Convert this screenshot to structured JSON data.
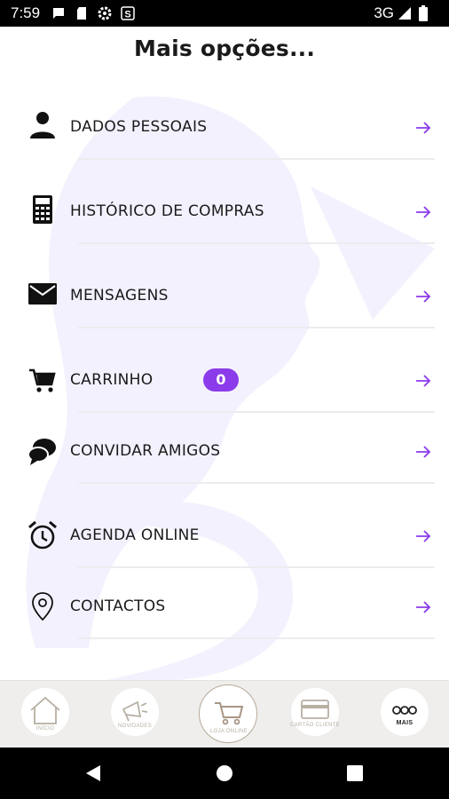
{
  "status_bar": {
    "time": "7:59",
    "network": "3G",
    "icons": [
      "message-icon",
      "sd-card-icon",
      "settings-icon",
      "s-app-icon",
      "signal-icon",
      "battery-icon"
    ]
  },
  "header": {
    "title": "Mais opções..."
  },
  "menu": {
    "accent_color": "#8b3be9",
    "items": [
      {
        "label": "DADOS PESSOAIS",
        "icon": "person-icon"
      },
      {
        "label": "HISTÓRICO DE COMPRAS",
        "icon": "calculator-icon"
      },
      {
        "label": "MENSAGENS",
        "icon": "mail-icon"
      },
      {
        "label": "CARRINHO",
        "icon": "cart-icon",
        "badge": "0"
      },
      {
        "label": "CONVIDAR AMIGOS",
        "icon": "chat-bubbles-icon"
      },
      {
        "label": "AGENDA ONLINE",
        "icon": "alarm-clock-icon"
      },
      {
        "label": "CONTACTOS",
        "icon": "location-pin-icon"
      }
    ]
  },
  "tabbar": {
    "tabs": [
      {
        "label": "INÍCIO",
        "icon": "home-icon"
      },
      {
        "label": "NOVIDADES",
        "icon": "megaphone-icon"
      },
      {
        "label": "LOJA ONLINE",
        "icon": "cart-icon"
      },
      {
        "label": "CARTÃO CLIENTE",
        "icon": "card-icon"
      },
      {
        "label": "MAIS",
        "icon": "more-icon"
      }
    ]
  }
}
